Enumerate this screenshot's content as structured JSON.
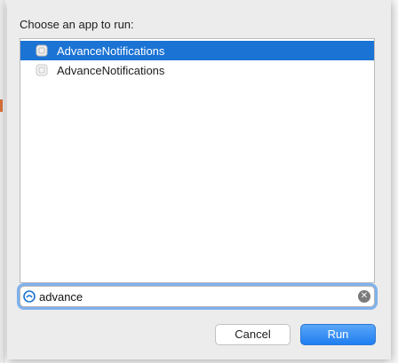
{
  "dialog": {
    "prompt": "Choose an app to run:",
    "apps": [
      {
        "label": "AdvanceNotifications",
        "selected": true
      },
      {
        "label": "AdvanceNotifications",
        "selected": false
      }
    ],
    "search": {
      "value": "advance",
      "placeholder": ""
    },
    "buttons": {
      "cancel": "Cancel",
      "run": "Run"
    },
    "colors": {
      "selection": "#1b73d4",
      "accent": "#2f8af2"
    }
  }
}
